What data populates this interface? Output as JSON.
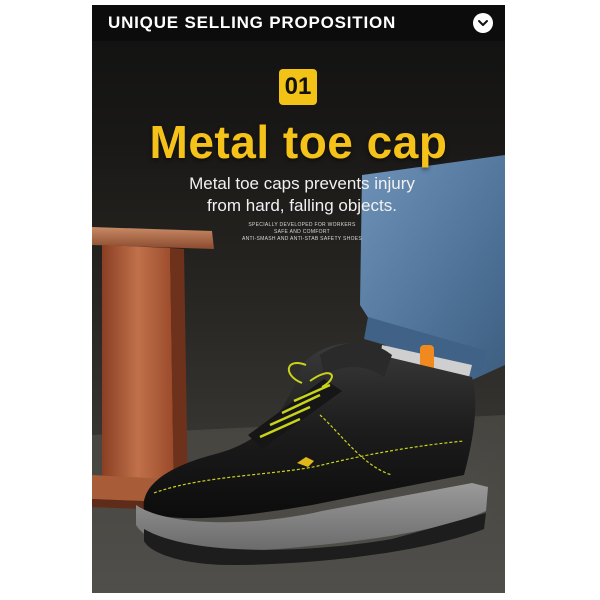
{
  "header": {
    "title": "UNIQUE SELLING PROPOSITION",
    "menu_icon": "chevron-down-icon"
  },
  "badge": {
    "number": "01"
  },
  "headline": "Metal toe cap",
  "subtitle": {
    "line1": "Metal toe caps prevents injury",
    "line2": "from hard, falling objects."
  },
  "fineprint": {
    "line1": "SPECIALLY DEVELOPED FOR WORKERS",
    "line2": "SAFE AND COMFORT",
    "line3": "ANTI-SMASH AND ANTI-STAB SAFETY SHOES"
  },
  "colors": {
    "accent_yellow": "#f2c316",
    "header_bg": "#0c0c0c",
    "rust_beam": "#b0603c",
    "denim": "#5a7ea3",
    "sock_orange": "#f08a1f"
  }
}
